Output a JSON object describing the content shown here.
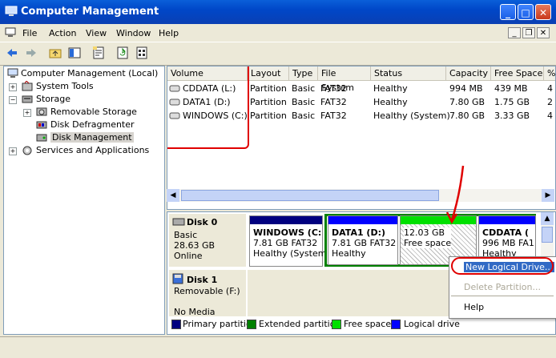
{
  "window": {
    "title": "Computer Management"
  },
  "menu": {
    "items": [
      "File",
      "Action",
      "View",
      "Window",
      "Help"
    ]
  },
  "tree": {
    "root": "Computer Management (Local)",
    "items": [
      {
        "label": "System Tools"
      },
      {
        "label": "Storage"
      },
      {
        "label": "Removable Storage"
      },
      {
        "label": "Disk Defragmenter"
      },
      {
        "label": "Disk Management"
      },
      {
        "label": "Services and Applications"
      }
    ]
  },
  "volumes": {
    "headers": [
      "Volume",
      "Layout",
      "Type",
      "File System",
      "Status",
      "Capacity",
      "Free Space",
      "%"
    ],
    "rows": [
      [
        "CDDATA (L:)",
        "Partition",
        "Basic",
        "FAT32",
        "Healthy",
        "994 MB",
        "439 MB",
        "4"
      ],
      [
        "DATA1 (D:)",
        "Partition",
        "Basic",
        "FAT32",
        "Healthy",
        "7.80 GB",
        "1.75 GB",
        "2"
      ],
      [
        "WINDOWS (C:)",
        "Partition",
        "Basic",
        "FAT32",
        "Healthy (System)",
        "7.80 GB",
        "3.33 GB",
        "4"
      ]
    ]
  },
  "disks": [
    {
      "name": "Disk 0",
      "type": "Basic",
      "size": "28.63 GB",
      "state": "Online"
    },
    {
      "name": "Disk 1",
      "type": "Removable (F:)",
      "size": "",
      "state": "No Media"
    }
  ],
  "partitions": [
    {
      "name": "WINDOWS (C:",
      "size": "7.81 GB FAT32",
      "status": "Healthy (System"
    },
    {
      "name": "DATA1 (D:)",
      "size": "7.81 GB FAT32",
      "status": "Healthy"
    },
    {
      "name": "",
      "size": "12.03 GB",
      "status": "Free space"
    },
    {
      "name": "CDDATA (",
      "size": "996 MB FA1",
      "status": "Healthy"
    }
  ],
  "legend": [
    "Primary partition",
    "Extended partition",
    "Free space",
    "Logical drive"
  ],
  "context_menu": {
    "items": [
      "New Logical Drive...",
      "Delete Partition...",
      "Help"
    ]
  },
  "colors": {
    "primary": "#000080",
    "extended": "#008000",
    "free": "#00e000",
    "logical": "#0000ff",
    "annotation": "#e00000"
  }
}
